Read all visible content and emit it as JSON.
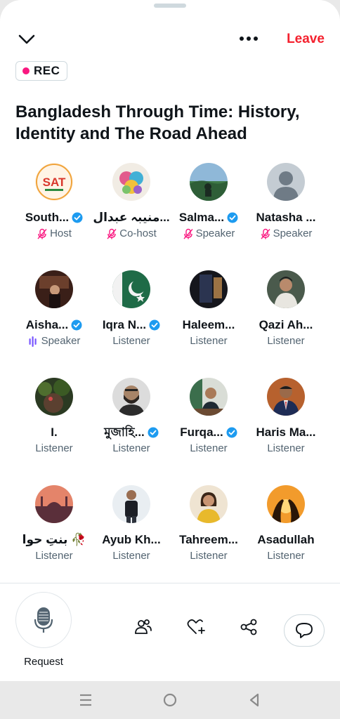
{
  "header": {
    "leave_label": "Leave",
    "rec_label": "REC"
  },
  "space": {
    "title": "Bangladesh Through Time: History, Identity and The Road Ahead"
  },
  "participants": [
    {
      "name": "South...",
      "role": "Host",
      "verified": true,
      "muted": true,
      "speaking": false,
      "avatar": "sat-logo"
    },
    {
      "name": "منیبہ عبدال...",
      "role": "Co-host",
      "verified": false,
      "muted": true,
      "speaking": false,
      "avatar": "painted-face"
    },
    {
      "name": "Salma...",
      "role": "Speaker",
      "verified": true,
      "muted": true,
      "speaking": false,
      "avatar": "landscape"
    },
    {
      "name": "Natasha ...",
      "role": "Speaker",
      "verified": false,
      "muted": true,
      "speaking": false,
      "avatar": "default-person"
    },
    {
      "name": "Aisha...",
      "role": "Speaker",
      "verified": true,
      "muted": false,
      "speaking": true,
      "avatar": "dark-room"
    },
    {
      "name": "Iqra N...",
      "role": "Listener",
      "verified": true,
      "muted": false,
      "speaking": false,
      "avatar": "green-flag"
    },
    {
      "name": "Haleem...",
      "role": "Listener",
      "verified": false,
      "muted": false,
      "speaking": false,
      "avatar": "dark-window"
    },
    {
      "name": "Qazi Ah...",
      "role": "Listener",
      "verified": false,
      "muted": false,
      "speaking": false,
      "avatar": "man-scarf"
    },
    {
      "name": "I.",
      "role": "Listener",
      "verified": false,
      "muted": false,
      "speaking": false,
      "avatar": "forest"
    },
    {
      "name": "মুজাহি...",
      "role": "Listener",
      "verified": true,
      "muted": false,
      "speaking": false,
      "avatar": "bearded-man"
    },
    {
      "name": "Furqa...",
      "role": "Listener",
      "verified": true,
      "muted": false,
      "speaking": false,
      "avatar": "man-desk"
    },
    {
      "name": "Haris Ma...",
      "role": "Listener",
      "verified": false,
      "muted": false,
      "speaking": false,
      "avatar": "man-suit"
    },
    {
      "name": "بنتِ حوا 🥀",
      "role": "Listener",
      "verified": false,
      "muted": false,
      "speaking": false,
      "avatar": "mosque-sunset"
    },
    {
      "name": "Ayub Kh...",
      "role": "Listener",
      "verified": false,
      "muted": false,
      "speaking": false,
      "avatar": "man-standing"
    },
    {
      "name": "Tahreem...",
      "role": "Listener",
      "verified": false,
      "muted": false,
      "speaking": false,
      "avatar": "woman-yellow"
    },
    {
      "name": "Asadullah",
      "role": "Listener",
      "verified": false,
      "muted": false,
      "speaking": false,
      "avatar": "hands-sunset"
    }
  ],
  "footer": {
    "request_label": "Request"
  },
  "colors": {
    "accent_red": "#f4212e",
    "verified_blue": "#1d9bf0",
    "muted_pink": "#f91880",
    "speaking_purple": "#7856ff",
    "rec_dot": "#f91880"
  }
}
